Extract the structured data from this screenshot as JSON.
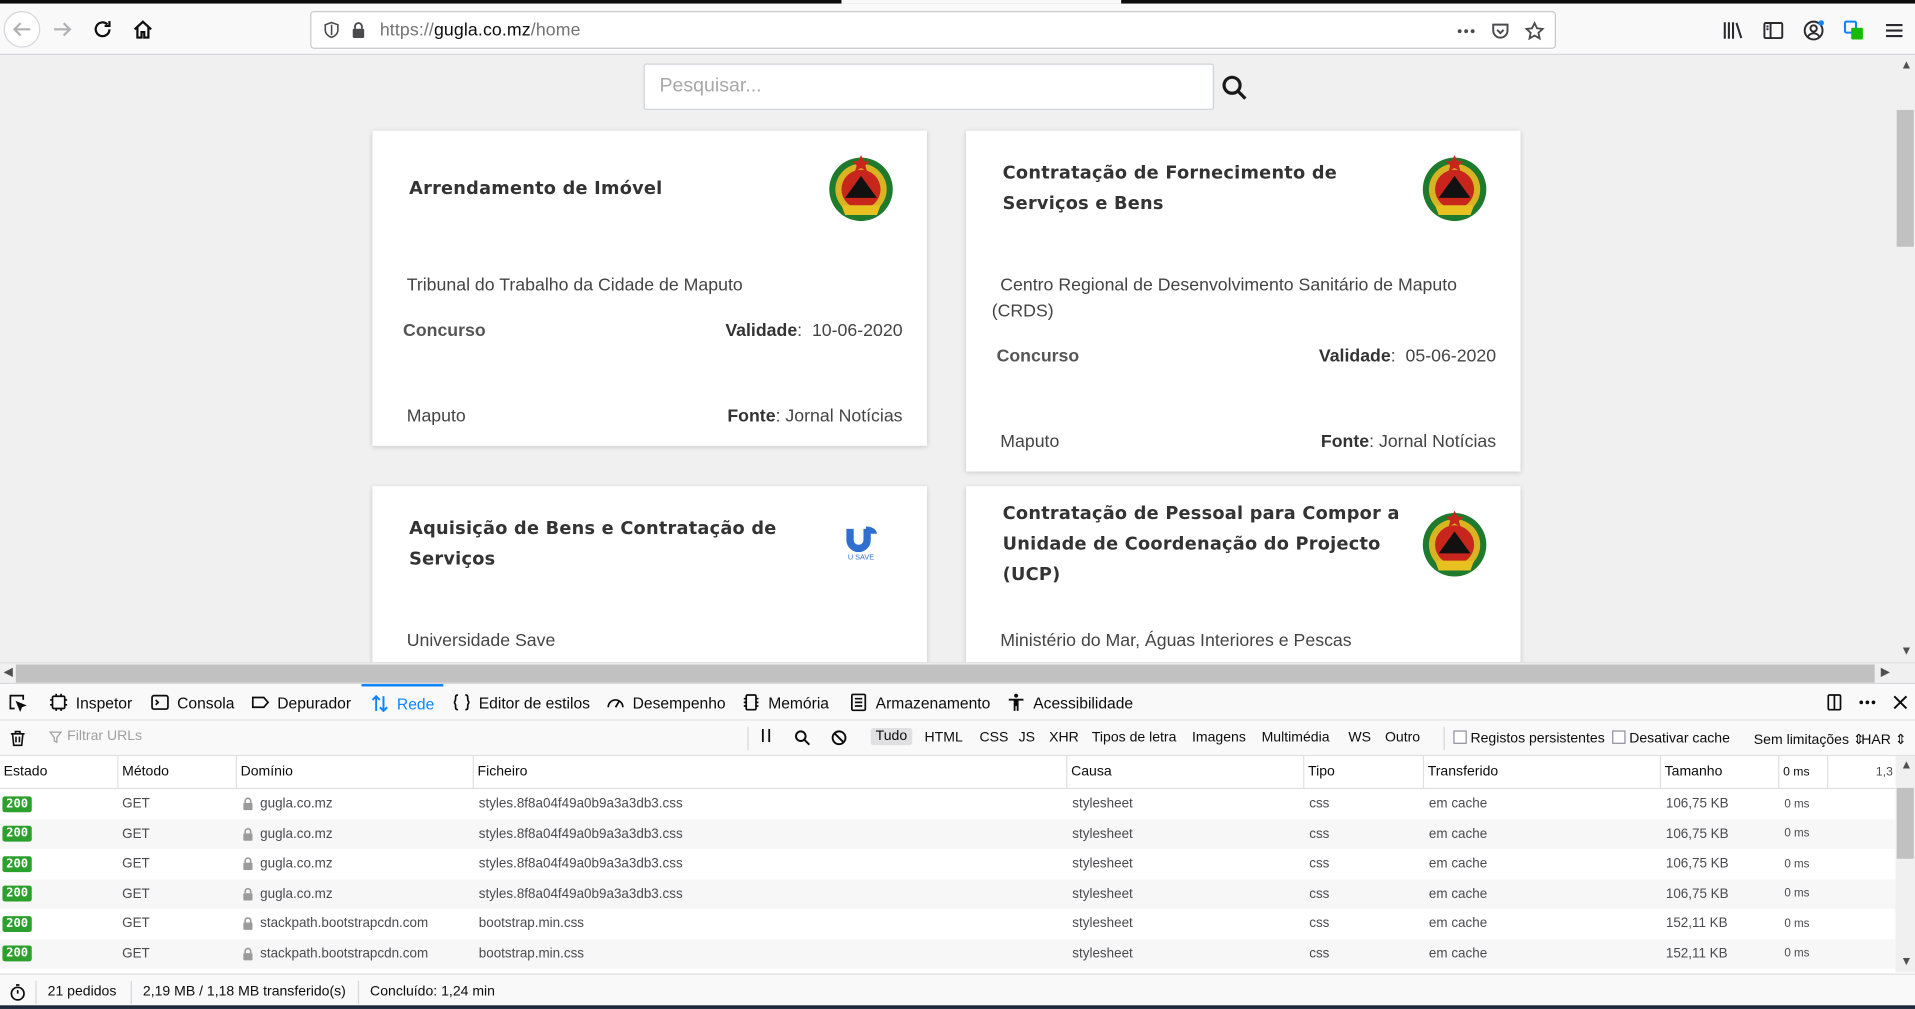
{
  "browser": {
    "url_scheme": "https://",
    "url_domain": "gugla.co.mz",
    "url_path": "/home"
  },
  "page": {
    "search_placeholder": "Pesquisar...",
    "cards": [
      {
        "title_line1": "Arrendamento de Imóvel",
        "title_line2": "",
        "title_line3": "",
        "logo": "mozambique-emblem-icon",
        "entity": "Tribunal do Trabalho da Cidade de Maputo",
        "entity_line2": "",
        "type": "Concurso",
        "validity_label": "Validade",
        "validity_date": "10-06-2020",
        "location": "Maputo",
        "source_label": "Fonte",
        "source_value": "Jornal Notícias"
      },
      {
        "title_line1": "Contratação de Fornecimento de",
        "title_line2": "Serviços e Bens",
        "title_line3": "",
        "logo": "mozambique-emblem-icon",
        "entity": "Centro Regional de Desenvolvimento Sanitário de Maputo",
        "entity_line2": "(CRDS)",
        "type": "Concurso",
        "validity_label": "Validade",
        "validity_date": "05-06-2020",
        "location": "Maputo",
        "source_label": "Fonte",
        "source_value": "Jornal Notícias"
      },
      {
        "title_line1": "Aquisição de Bens e Contratação de",
        "title_line2": "Serviços",
        "title_line3": "",
        "logo": "unisave-logo-icon",
        "logo_text": "U SAVE",
        "entity": "Universidade Save"
      },
      {
        "title_line1": "Contratação de Pessoal para Compor a",
        "title_line2": "Unidade de Coordenação do Projecto",
        "title_line3": "(UCP)",
        "logo": "mozambique-emblem-icon",
        "entity": "Ministério do Mar, Águas Interiores e Pescas"
      }
    ]
  },
  "devtools": {
    "tabs": [
      "Inspetor",
      "Consola",
      "Depurador",
      "Rede",
      "Editor de estilos",
      "Desempenho",
      "Memória",
      "Armazenamento",
      "Acessibilidade"
    ],
    "active_tab": "Rede",
    "filter_placeholder": "Filtrar URLs",
    "type_filters": [
      "Tudo",
      "HTML",
      "CSS",
      "JS",
      "XHR",
      "Tipos de letra",
      "Imagens",
      "Multimédia",
      "WS",
      "Outro"
    ],
    "persist_logs": "Registos persistentes",
    "disable_cache": "Desativar cache",
    "throttling": "Sem limitações",
    "har": "HAR",
    "columns": [
      "Estado",
      "Método",
      "Domínio",
      "Ficheiro",
      "Causa",
      "Tipo",
      "Transferido",
      "Tamanho",
      "0 ms",
      "1,3"
    ],
    "rows": [
      {
        "status": "200",
        "method": "GET",
        "domain": "gugla.co.mz",
        "file": "styles.8f8a04f49a0b9a3a3db3.css",
        "cause": "stylesheet",
        "type": "css",
        "transferred": "em cache",
        "size": "106,75 KB",
        "time": "0 ms"
      },
      {
        "status": "200",
        "method": "GET",
        "domain": "gugla.co.mz",
        "file": "styles.8f8a04f49a0b9a3a3db3.css",
        "cause": "stylesheet",
        "type": "css",
        "transferred": "em cache",
        "size": "106,75 KB",
        "time": "0 ms"
      },
      {
        "status": "200",
        "method": "GET",
        "domain": "gugla.co.mz",
        "file": "styles.8f8a04f49a0b9a3a3db3.css",
        "cause": "stylesheet",
        "type": "css",
        "transferred": "em cache",
        "size": "106,75 KB",
        "time": "0 ms"
      },
      {
        "status": "200",
        "method": "GET",
        "domain": "gugla.co.mz",
        "file": "styles.8f8a04f49a0b9a3a3db3.css",
        "cause": "stylesheet",
        "type": "css",
        "transferred": "em cache",
        "size": "106,75 KB",
        "time": "0 ms"
      },
      {
        "status": "200",
        "method": "GET",
        "domain": "stackpath.bootstrapcdn.com",
        "file": "bootstrap.min.css",
        "cause": "stylesheet",
        "type": "css",
        "transferred": "em cache",
        "size": "152,11 KB",
        "time": "0 ms"
      },
      {
        "status": "200",
        "method": "GET",
        "domain": "stackpath.bootstrapcdn.com",
        "file": "bootstrap.min.css",
        "cause": "stylesheet",
        "type": "css",
        "transferred": "em cache",
        "size": "152,11 KB",
        "time": "0 ms"
      }
    ],
    "footer": {
      "requests": "21 pedidos",
      "transferred": "2,19 MB / 1,18 MB transferido(s)",
      "finished": "Concluído: 1,24 min"
    }
  },
  "colors": {
    "accent": "#0a84ff",
    "status_ok": "#2ca02c"
  }
}
